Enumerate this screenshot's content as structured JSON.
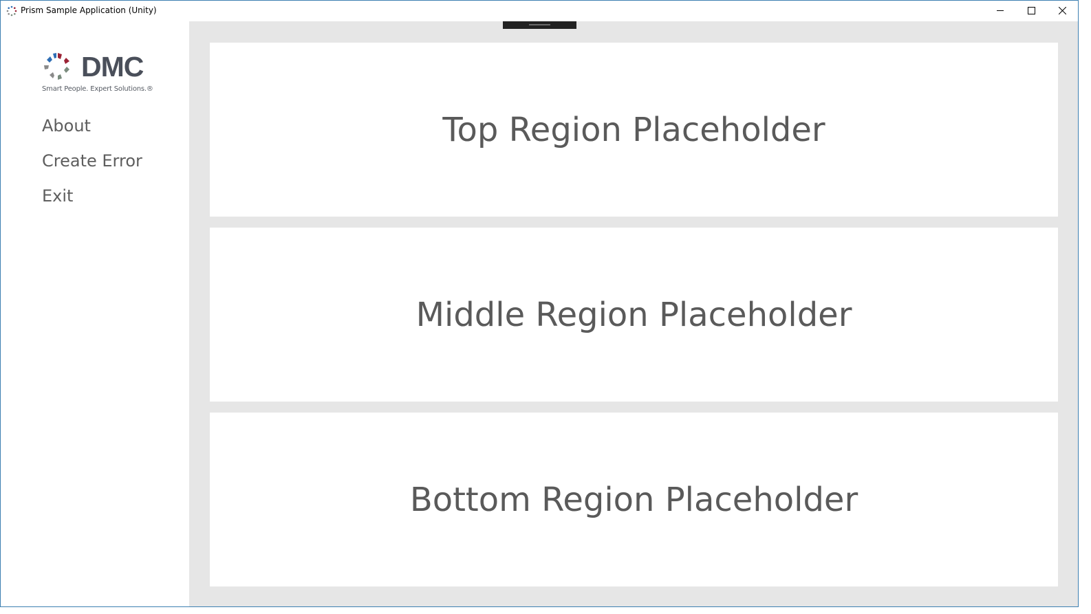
{
  "window": {
    "title": "Prism Sample Application (Unity)",
    "icon": "prism-app-icon",
    "controls": {
      "minimize_icon": "minimize-icon",
      "maximize_icon": "maximize-icon",
      "close_icon": "close-icon"
    }
  },
  "sidebar": {
    "logo": {
      "wordmark": "DMC",
      "tagline": "Smart People. Expert Solutions.®",
      "colors": [
        "#2e6db4",
        "#9b2335",
        "#7a8c7e",
        "#8a8a8a"
      ]
    },
    "items": [
      {
        "label": "About"
      },
      {
        "label": "Create Error"
      },
      {
        "label": "Exit"
      }
    ]
  },
  "regions": {
    "top": {
      "label": "Top Region Placeholder"
    },
    "middle": {
      "label": "Middle Region Placeholder"
    },
    "bottom": {
      "label": "Bottom Region Placeholder"
    }
  },
  "colors": {
    "content_background": "#e6e6e6",
    "region_background": "#ffffff",
    "text": "#5a5a5a",
    "window_border": "#3c7fb1",
    "drawer_handle": "#222222"
  }
}
